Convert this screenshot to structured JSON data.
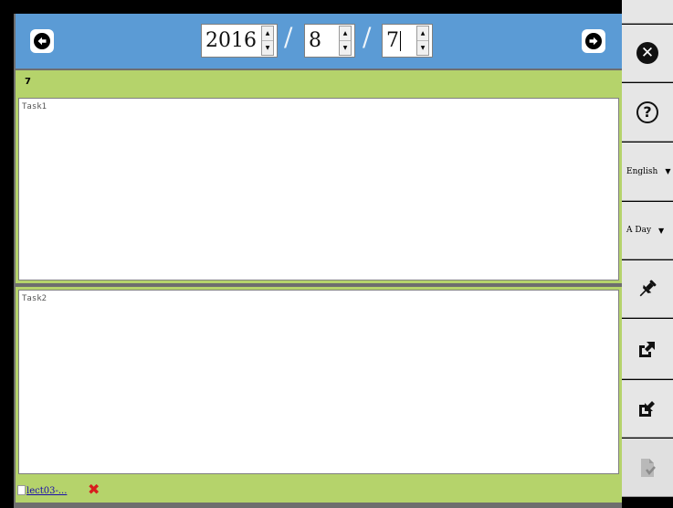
{
  "date": {
    "year": "2016",
    "month": "8",
    "day": "7",
    "separator": "/"
  },
  "navigation": {
    "prev_icon": "arrow-left-circle-icon",
    "next_icon": "arrow-right-circle-icon"
  },
  "day_header": {
    "label": "7"
  },
  "tasks": [
    {
      "placeholder": "Task1"
    },
    {
      "placeholder": "Task2"
    }
  ],
  "attachment": {
    "file_name": "lect03-...",
    "remove_icon": "remove-x-icon"
  },
  "toolbar": {
    "language": {
      "selected": "English"
    },
    "view_mode": {
      "selected": "A Day"
    },
    "icons": [
      "close-icon",
      "help-icon",
      "pin-icon",
      "export-icon",
      "import-icon",
      "saved-document-icon"
    ]
  },
  "colors": {
    "date_bar": "#5b9bd5",
    "task_frame": "#b5d36b",
    "toolbar_button": "#e6e6e6",
    "remove_icon": "#d81e1e"
  }
}
